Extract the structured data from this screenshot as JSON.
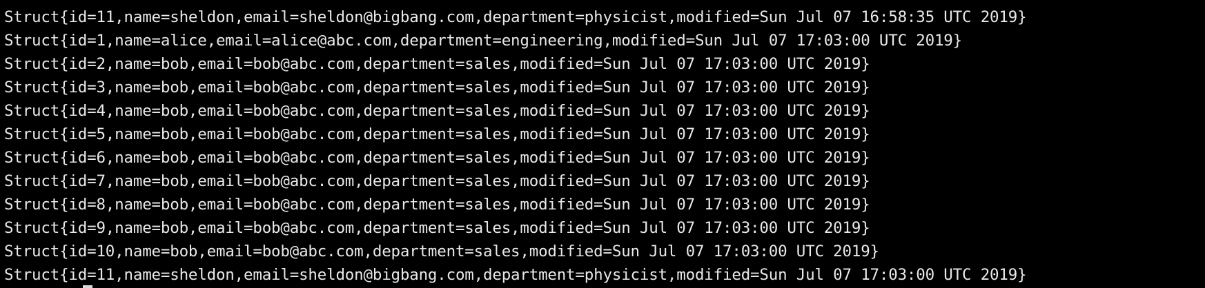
{
  "terminal": {
    "lines": [
      "Struct{id=11,name=sheldon,email=sheldon@bigbang.com,department=physicist,modified=Sun Jul 07 16:58:35 UTC 2019}",
      "Struct{id=1,name=alice,email=alice@abc.com,department=engineering,modified=Sun Jul 07 17:03:00 UTC 2019}",
      "Struct{id=2,name=bob,email=bob@abc.com,department=sales,modified=Sun Jul 07 17:03:00 UTC 2019}",
      "Struct{id=3,name=bob,email=bob@abc.com,department=sales,modified=Sun Jul 07 17:03:00 UTC 2019}",
      "Struct{id=4,name=bob,email=bob@abc.com,department=sales,modified=Sun Jul 07 17:03:00 UTC 2019}",
      "Struct{id=5,name=bob,email=bob@abc.com,department=sales,modified=Sun Jul 07 17:03:00 UTC 2019}",
      "Struct{id=6,name=bob,email=bob@abc.com,department=sales,modified=Sun Jul 07 17:03:00 UTC 2019}",
      "Struct{id=7,name=bob,email=bob@abc.com,department=sales,modified=Sun Jul 07 17:03:00 UTC 2019}",
      "Struct{id=8,name=bob,email=bob@abc.com,department=sales,modified=Sun Jul 07 17:03:00 UTC 2019}",
      "Struct{id=9,name=bob,email=bob@abc.com,department=sales,modified=Sun Jul 07 17:03:00 UTC 2019}",
      "Struct{id=10,name=bob,email=bob@abc.com,department=sales,modified=Sun Jul 07 17:03:00 UTC 2019}",
      "Struct{id=11,name=sheldon,email=sheldon@bigbang.com,department=physicist,modified=Sun Jul 07 17:03:00 UTC 2019}"
    ]
  },
  "colors": {
    "background": "#000000",
    "text": "#e8e8e8",
    "cursor": "#d8d8d8"
  }
}
